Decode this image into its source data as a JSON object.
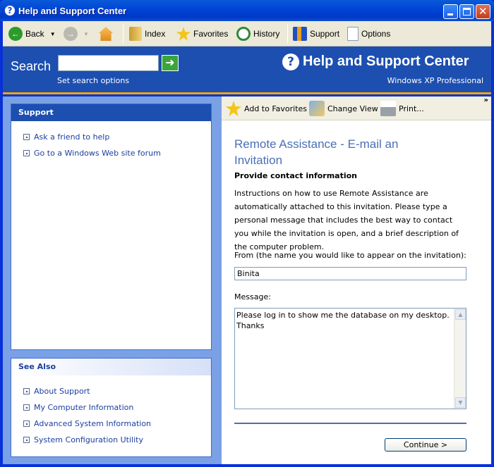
{
  "window": {
    "title": "Help and Support Center"
  },
  "toolbar": {
    "back": "Back",
    "index": "Index",
    "favorites": "Favorites",
    "history": "History",
    "support": "Support",
    "options": "Options"
  },
  "search": {
    "label": "Search",
    "value": "",
    "options_link": "Set search options"
  },
  "brand": {
    "title": "Help and Support Center",
    "subtitle": "Windows XP Professional"
  },
  "sidebar": {
    "support": {
      "heading": "Support",
      "links": [
        "Ask a friend to help",
        "Go to a Windows Web site forum"
      ]
    },
    "see_also": {
      "heading": "See Also",
      "links": [
        "About Support",
        "My Computer Information",
        "Advanced System Information",
        "System Configuration Utility"
      ]
    }
  },
  "content_toolbar": {
    "add_favorites": "Add to Favorites",
    "change_view": "Change View",
    "print": "Print..."
  },
  "content": {
    "title": "Remote Assistance - E-mail an Invitation",
    "subheading": "Provide contact information",
    "instructions": "Instructions on how to use Remote Assistance are automatically attached to this invitation. Please type a personal message that includes the best way to contact you while the invitation is open, and a brief description of the computer problem.",
    "from_label": "From (the name you would like to appear on the invitation):",
    "from_value": "Binita",
    "message_label": "Message:",
    "message_value": "Please log in to show me the database on my desktop.\nThanks",
    "continue": "Continue >"
  },
  "colors": {
    "title_bar": "#0046d5",
    "header_blue": "#1c4fb0",
    "accent_orange": "#f0a60a",
    "link_blue": "#1c3fa0",
    "title_text": "#4a6fb5"
  }
}
